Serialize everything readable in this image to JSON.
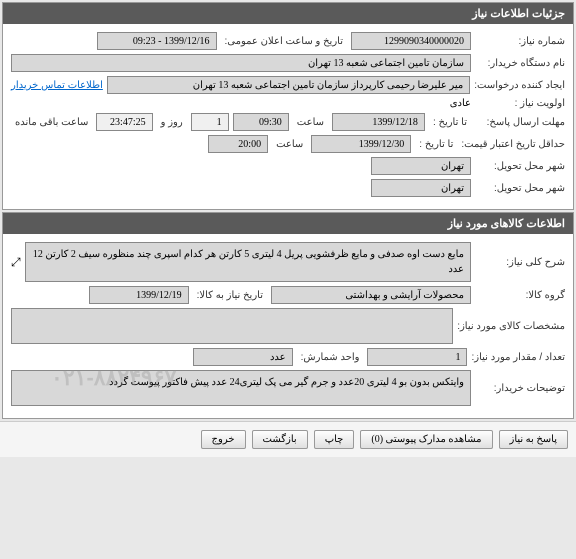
{
  "panel1": {
    "title": "جزئیات اطلاعات نیاز",
    "need_number_label": "شماره نیاز:",
    "need_number": "1299090340000020",
    "announce_label": "تاریخ و ساعت اعلان عمومی:",
    "announce_value": "1399/12/16 - 09:23",
    "buyer_label": "نام دستگاه خریدار:",
    "buyer_value": "سازمان تامین اجتماعی شعبه 13 تهران",
    "creator_label": "ایجاد کننده درخواست:",
    "creator_value": "میر علیرضا  رحیمی  کارپرداز سازمان تامین اجتماعی شعبه 13 تهران",
    "contact_link": "اطلاعات تماس خریدار",
    "priority_label": "اولویت نیاز :",
    "priority_value": "عادی",
    "deadline_label": "مهلت ارسال پاسخ:",
    "to_date_label": "تا تاریخ :",
    "deadline_date": "1399/12/18",
    "time_label": "ساعت",
    "deadline_time": "09:30",
    "day_value": "1",
    "day_label": "روز و",
    "remain_time": "23:47:25",
    "remain_label": "ساعت باقی مانده",
    "validity_label": "حداقل تاریخ اعتبار قیمت:",
    "validity_date": "1399/12/30",
    "validity_time": "20:00",
    "delivery_city_label": "شهر محل تحویل:",
    "delivery_city1": "تهران",
    "delivery_city2": "تهران"
  },
  "panel2": {
    "title": "اطلاعات کالاهای مورد نیاز",
    "desc_label": "شرح کلی نیاز:",
    "desc_value": "مایع دست اوه صدفی و مایع ظرفشویی پریل  4 لیتری 5 کارتن هر کدام اسپری چند منظوره سیف 2 کارتن 12 عدد",
    "expand_icon": "⤢",
    "group_label": "گروه کالا:",
    "group_value": "محصولات آرایشی و بهداشتی",
    "need_date_label": "تاریخ نیاز به کالا:",
    "need_date": "1399/12/19",
    "spec_label": "مشخصات کالای مورد نیاز:",
    "spec_value": "",
    "qty_label": "تعداد / مقدار مورد نیاز:",
    "qty_value": "1",
    "unit_label": "واحد شمارش:",
    "unit_value": "عدد",
    "buyer_notes_label": "توضیحات خریدار:",
    "buyer_notes_value": "وایتکس بدون بو 4 لیتری 20عدد و جرم گیر می پک لیتری24 عدد پیش فاکتور پیوست گردد",
    "watermark": "۰۲۱-۸۸۲۴۹۶۷"
  },
  "buttons": {
    "respond": "پاسخ به نیاز",
    "attachments": "مشاهده مدارک پیوستی",
    "attachments_count": "(0)",
    "print": "چاپ",
    "back": "بازگشت",
    "exit": "خروج"
  }
}
